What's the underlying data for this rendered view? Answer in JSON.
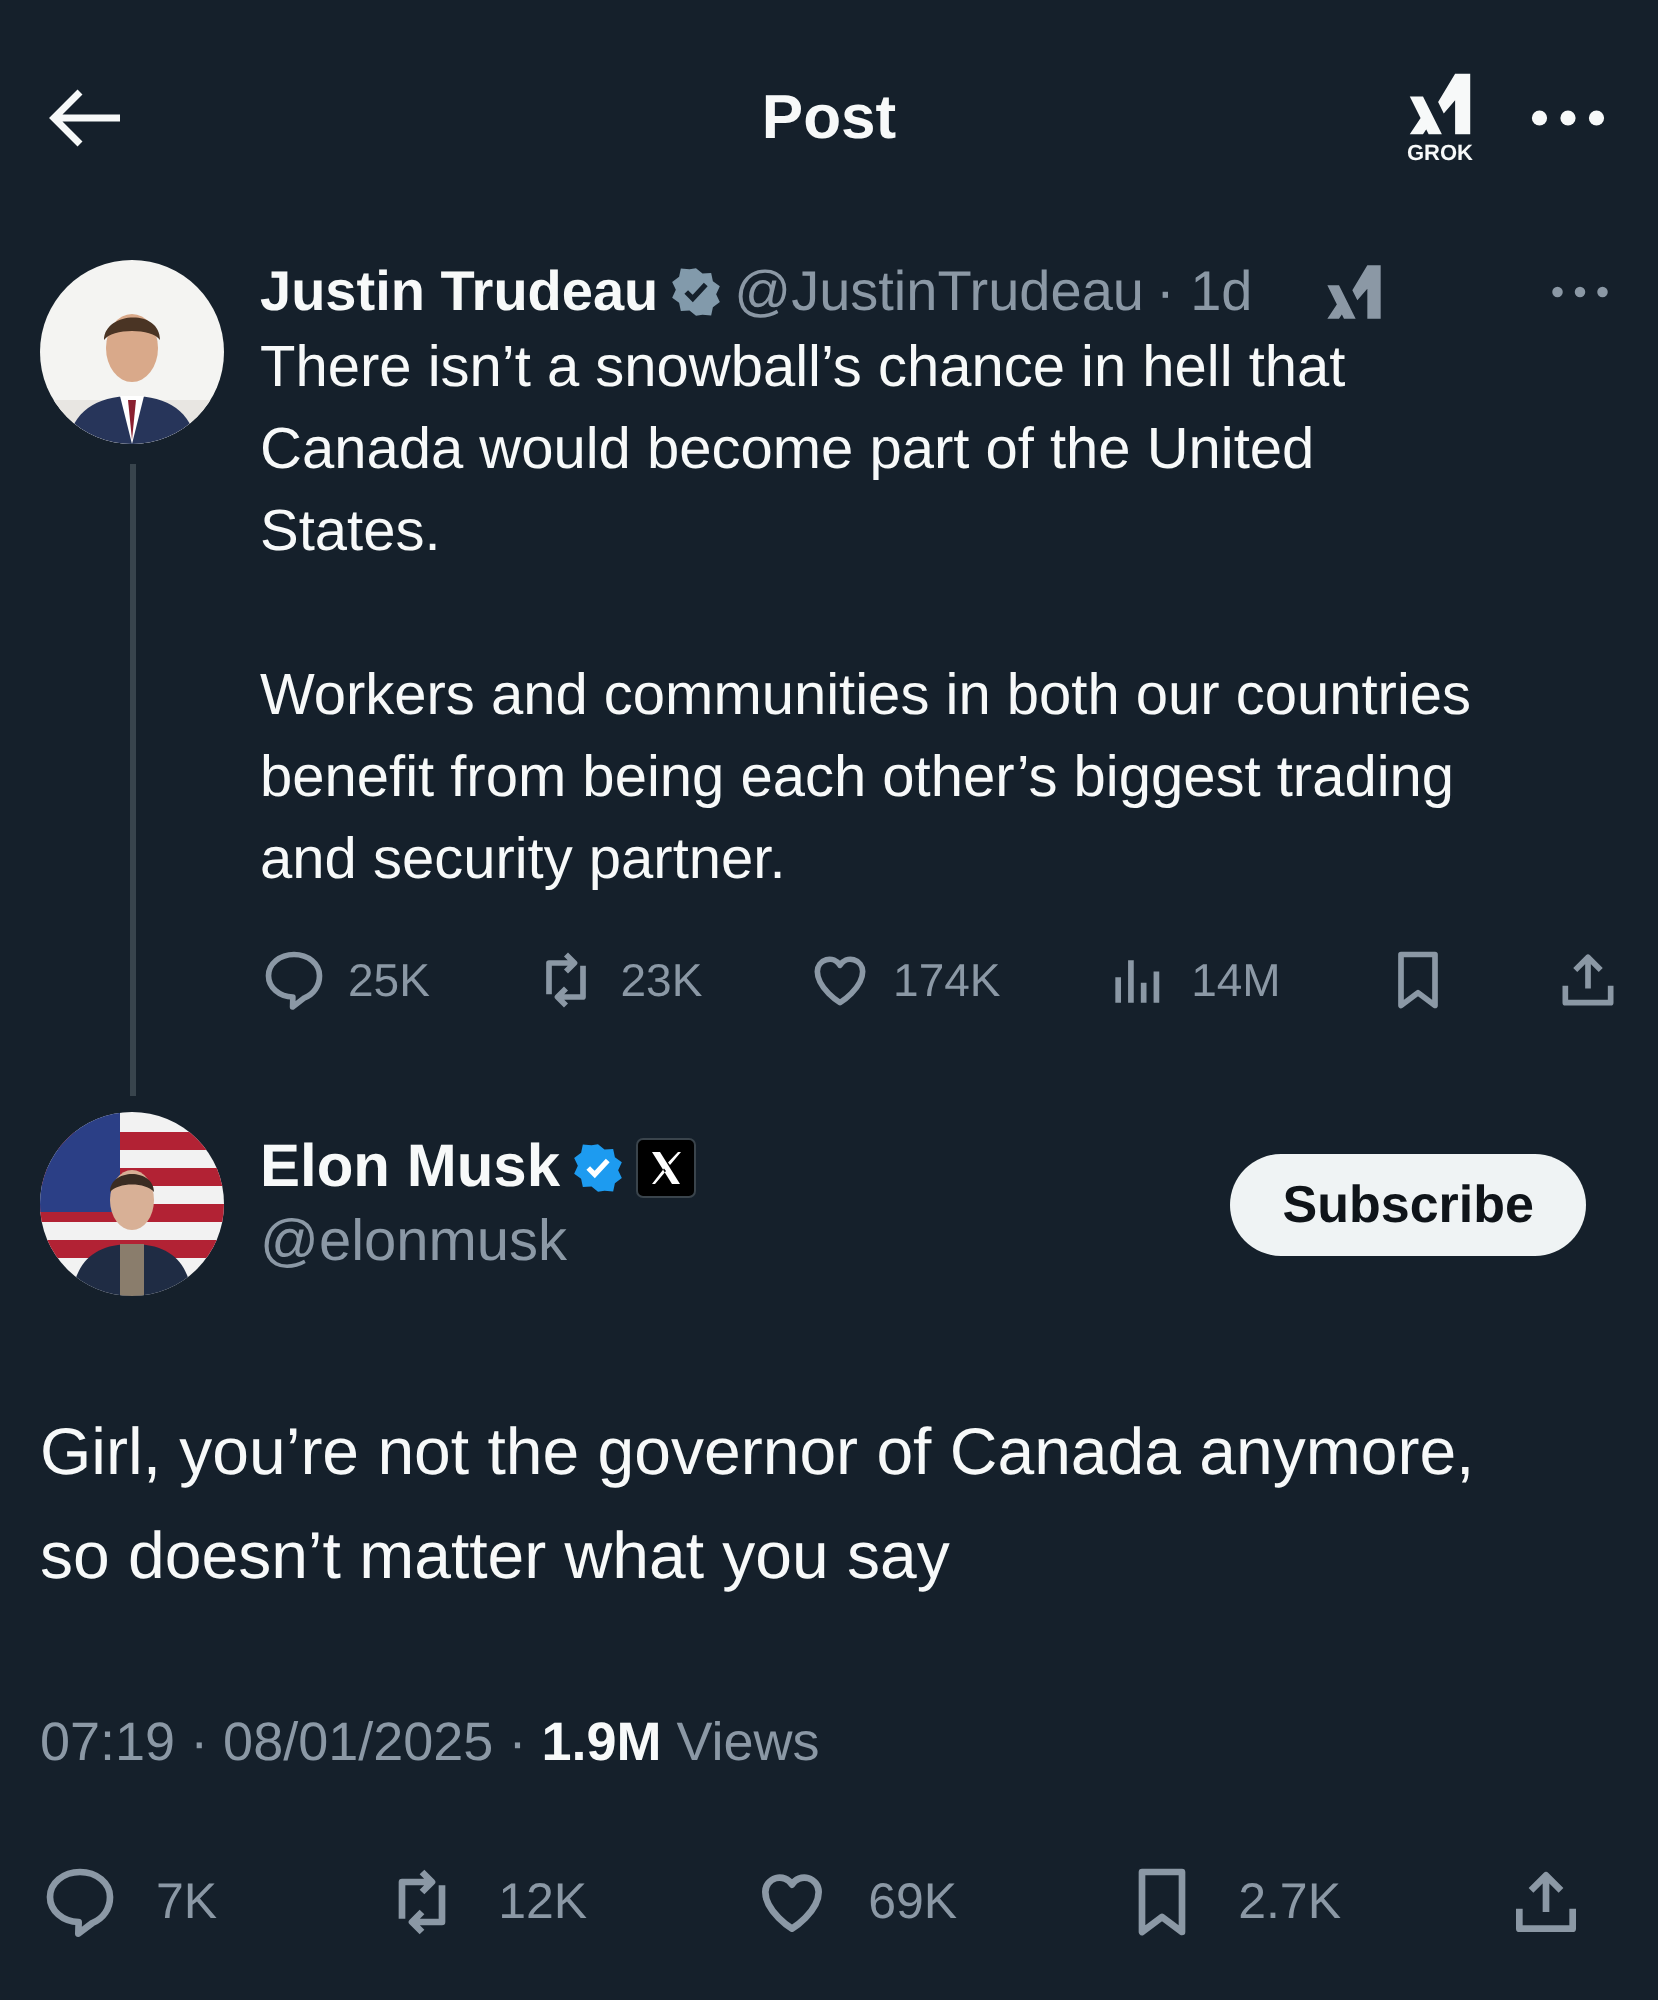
{
  "header": {
    "title": "Post",
    "grok_label": "GROK"
  },
  "parent_post": {
    "name": "Justin Trudeau",
    "badge": {
      "kind": "government"
    },
    "handle": "@JustinTrudeau",
    "time": "· 1d",
    "paragraphs": [
      "There isn’t a snowball’s chance in hell that Canada would become part of the United States.",
      "Workers and communities in both our countries benefit from being each other’s biggest trading and security partner."
    ],
    "actions": [
      {
        "kind": "reply",
        "count": "25K"
      },
      {
        "kind": "repost",
        "count": "23K"
      },
      {
        "kind": "like",
        "count": "174K"
      },
      {
        "kind": "views",
        "count": "14M"
      },
      {
        "kind": "bookmark"
      },
      {
        "kind": "share"
      }
    ]
  },
  "main_post": {
    "name": "Elon Musk",
    "badge": {
      "kind": "blue"
    },
    "affiliate": true,
    "handle": "@elonmusk",
    "subscribe_label": "Subscribe",
    "text": "Girl, you’re not the governor of Canada anymore, so doesn’t matter what you say",
    "meta": "07:19 · 08/01/2025 · **1.9M** Views",
    "actions": [
      {
        "kind": "reply",
        "count": "7K"
      },
      {
        "kind": "repost",
        "count": "12K"
      },
      {
        "kind": "like",
        "count": "69K"
      },
      {
        "kind": "bookmark",
        "count": "2.7K"
      },
      {
        "kind": "share"
      }
    ]
  }
}
